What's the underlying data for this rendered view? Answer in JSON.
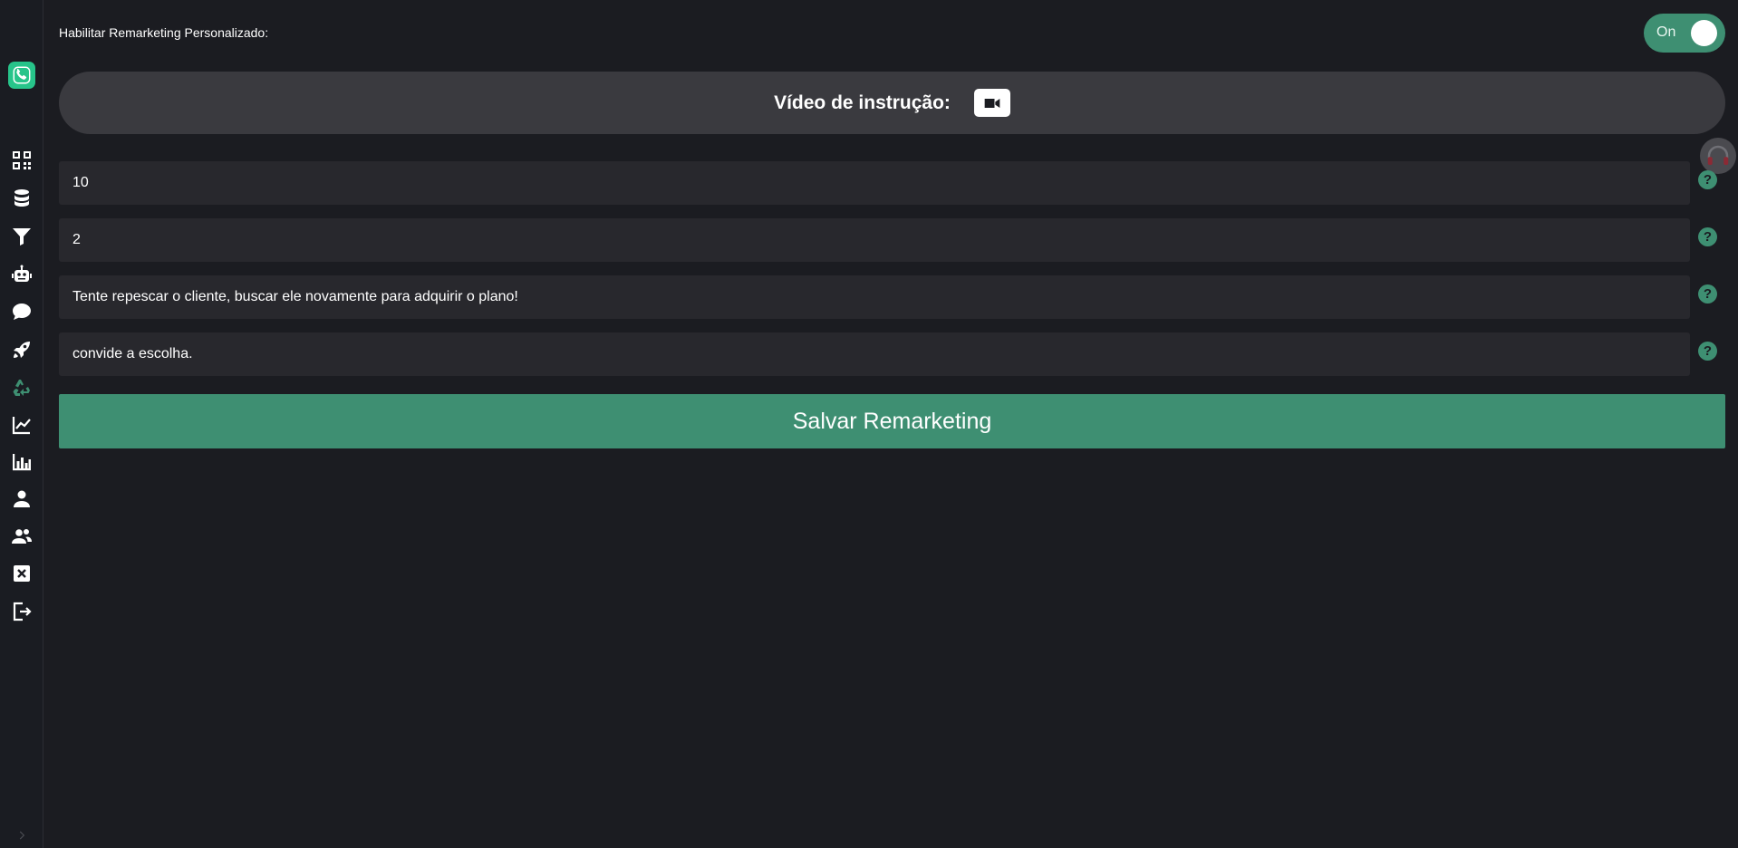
{
  "remarketing": {
    "toggle_label": "Habilitar Remarketing Personalizado:",
    "toggle_state": "On"
  },
  "video": {
    "title": "Vídeo de instrução:"
  },
  "fields": [
    {
      "value": "10"
    },
    {
      "value": "2"
    },
    {
      "value": "Tente repescar o cliente, buscar ele novamente para adquirir o plano!"
    },
    {
      "value": "convide a escolha."
    }
  ],
  "help_glyph": "?",
  "save_label": "Salvar Remarketing",
  "sidebar": {
    "items": [
      "qrcode-icon",
      "database-icon",
      "filter-icon",
      "robot-icon",
      "chat-icon",
      "rocket-icon",
      "recycle-icon",
      "line-chart-icon",
      "bar-chart-icon",
      "user-icon",
      "users-icon",
      "close-box-icon",
      "logout-icon"
    ]
  },
  "colors": {
    "accent": "#3e8f72",
    "background": "#1b1c21",
    "field": "#28282d",
    "video_bar": "#3a3a3f",
    "logo": "#27c48a"
  }
}
